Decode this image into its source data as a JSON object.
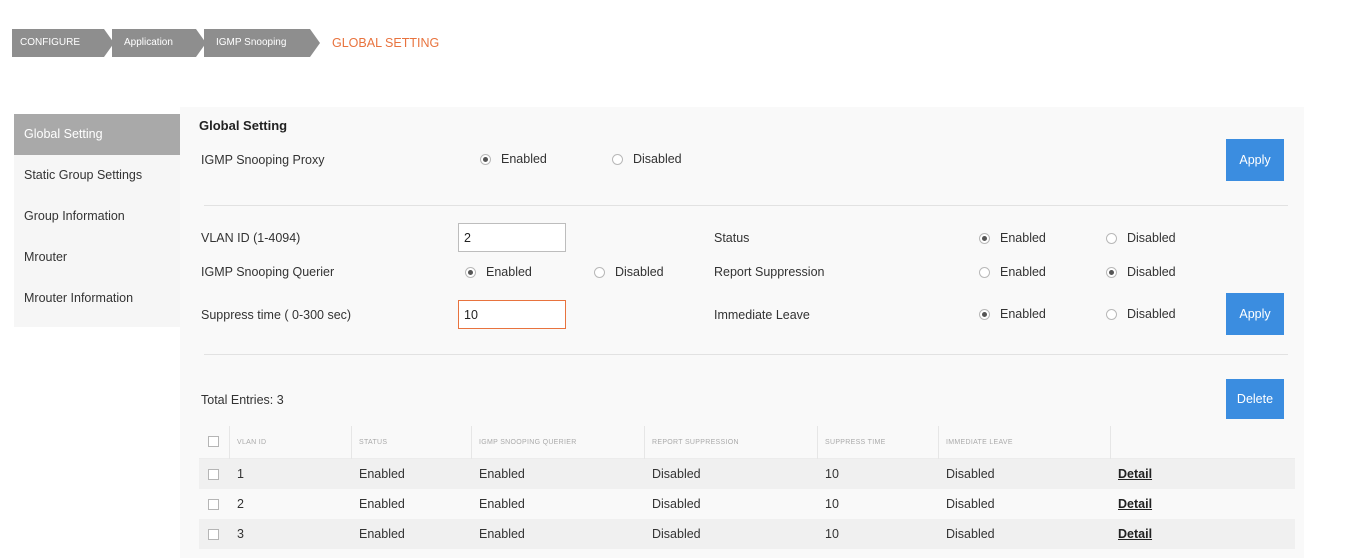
{
  "breadcrumb": {
    "items": [
      "CONFIGURE",
      "Application",
      "IGMP Snooping"
    ],
    "current": "GLOBAL SETTING"
  },
  "sidebar": {
    "items": [
      {
        "label": "Global Setting",
        "active": true
      },
      {
        "label": "Static Group Settings",
        "active": false
      },
      {
        "label": "Group Information",
        "active": false
      },
      {
        "label": "Mrouter",
        "active": false
      },
      {
        "label": "Mrouter Information",
        "active": false
      }
    ]
  },
  "global": {
    "title": "Global Setting",
    "proxy_label": "IGMP Snooping Proxy",
    "proxy_value": "Enabled",
    "apply_label": "Apply"
  },
  "vlan": {
    "vlan_id_label": "VLAN ID (1-4094)",
    "vlan_id_value": "2",
    "querier_label": "IGMP Snooping Querier",
    "querier_value": "Enabled",
    "suppress_label": "Suppress time ( 0-300 sec)",
    "suppress_value": "10",
    "status_label": "Status",
    "status_value": "Enabled",
    "report_label": "Report Suppression",
    "report_value": "Disabled",
    "leave_label": "Immediate Leave",
    "leave_value": "Enabled",
    "apply_label": "Apply"
  },
  "radio_labels": {
    "enabled": "Enabled",
    "disabled": "Disabled"
  },
  "table": {
    "total_label": "Total Entries: 3",
    "delete_label": "Delete",
    "columns": [
      "VLAN ID",
      "STATUS",
      "IGMP SNOOPING QUERIER",
      "REPORT SUPPRESSION",
      "SUPPRESS TIME",
      "IMMEDIATE LEAVE"
    ],
    "rows": [
      {
        "vlan": "1",
        "status": "Enabled",
        "querier": "Enabled",
        "report": "Disabled",
        "suppress": "10",
        "leave": "Disabled",
        "action": "Detail"
      },
      {
        "vlan": "2",
        "status": "Enabled",
        "querier": "Enabled",
        "report": "Disabled",
        "suppress": "10",
        "leave": "Disabled",
        "action": "Detail"
      },
      {
        "vlan": "3",
        "status": "Enabled",
        "querier": "Enabled",
        "report": "Disabled",
        "suppress": "10",
        "leave": "Disabled",
        "action": "Detail"
      }
    ]
  },
  "colors": {
    "accent": "#3b8de0",
    "breadcrumb_current": "#e8733e",
    "sidebar_active": "#a9a9a9"
  }
}
